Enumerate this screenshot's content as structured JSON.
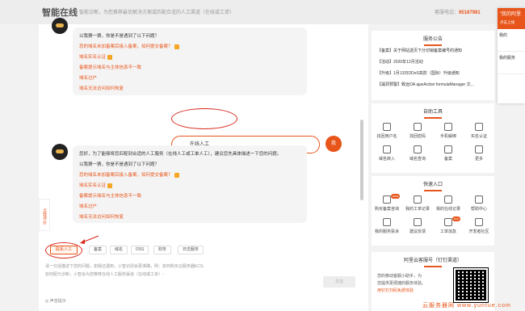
{
  "header": {
    "brand": "智能在线",
    "tagline": "智能诊断，为您推荐最优解决方案或匹配合适的人工渠道（在线或工单）",
    "hotline_label": "客服电话：",
    "hotline_number": "95187981"
  },
  "chat": {
    "bot_msg_1": {
      "intro": "以我猜一猜，你是不是遇到了以下问题？",
      "links": [
        "您的域名未加备案后接入备案，如何提交备案？",
        "域名实名认证",
        "备案提示域名与主体信息不一致",
        "域名过户",
        "域名无法访问如何恢复"
      ]
    },
    "user_msg": "在线人工",
    "user_avatar": "我",
    "bot_msg_2": {
      "intro1": "您好，为了能够将您匹配到合适的人工服务（在线人工或工单人工），建议您先具体描述一下您的问题。",
      "intro2": "以我猜一猜，你是不是遇到了以下问题？",
      "links": [
        "您的域名未加备案后接入备案，如何提交备案？",
        "域名实名认证",
        "备案提示域名与主体信息不一致",
        "域名过户",
        "域名无法访问如何恢复"
      ]
    },
    "side_tag": "点我评价",
    "tabs": [
      "联系人工",
      "备案",
      "域名",
      "OSS",
      "财务",
      "日志服务"
    ],
    "input_placeholder_1": "请一句话描述下您的问题，如我还遇到，小智识别会更准确，例：如何购买云服务器ECS-",
    "input_placeholder_2": "如何配元诊断，小智会为您推荐在线人工服务渠道（在线或工单）-",
    "send_label": "发送",
    "voice_label": "声音提示"
  },
  "announcements": {
    "title": "服务公告",
    "items": [
      {
        "tag": "【备案】",
        "text": "关于网站送页下分切销备案编号的通知"
      },
      {
        "tag": "【活动】",
        "text": "2020年12月活动"
      },
      {
        "tag": "【升级】",
        "text": "1月13日DDoS高防（国际）升级通知"
      },
      {
        "tag": "【漏洞预警】",
        "text": "致远OA ajaxAction formulaManager 文..."
      }
    ]
  },
  "tools": {
    "title": "自助工具",
    "items": [
      "找回用户名",
      "找回密码",
      "手机解绑",
      "实名认证",
      "域名转入",
      "域名查询",
      "备案",
      "更多"
    ]
  },
  "quick": {
    "title": "快速入口",
    "items": [
      "购买备案咨询",
      "我的工单记录",
      "我的在线记录",
      "帮助中心",
      "我的服务投诉",
      "建议反馈",
      "工单加急",
      "开发者社区"
    ],
    "badges": [
      "new",
      "hot"
    ]
  },
  "wechat": {
    "title": "阿里云客服号（钉钉渠道）",
    "line1": "您的移动客服小助手，为",
    "line2": "您提供更便捷的服务体验。",
    "line3": "用钉钉扫码免费体验"
  },
  "float_panel": {
    "title": "“我的阿里",
    "subtitle": "点击上线",
    "row1": "我的",
    "row2": "我的服务"
  },
  "watermark": "云服务器网 www.yuntue.com"
}
